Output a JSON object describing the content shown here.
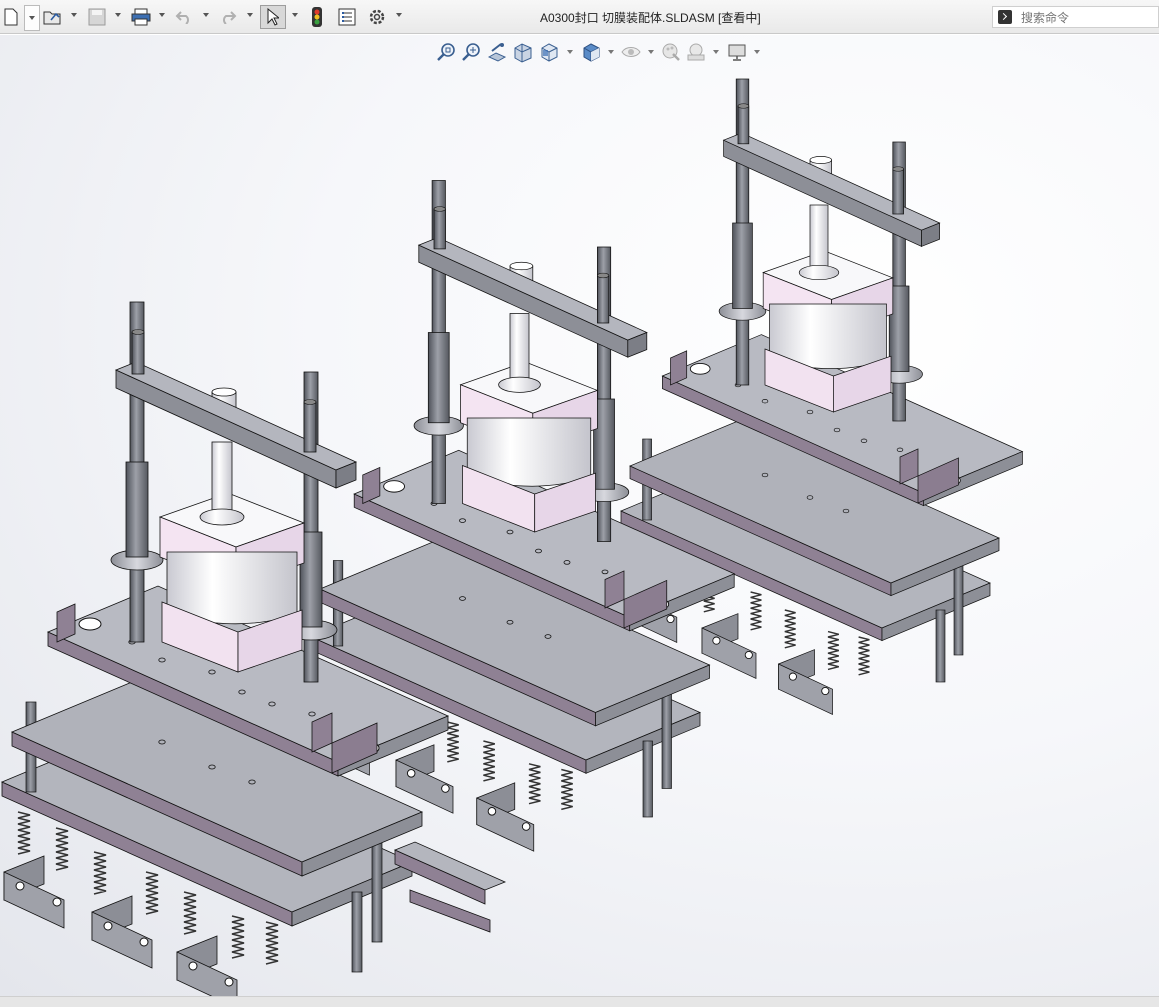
{
  "window": {
    "title": "A0300封口 切膜装配体.SLDASM [查看中]"
  },
  "toolbar": {
    "items": [
      {
        "name": "new-document",
        "icon": "new-document-icon"
      },
      {
        "name": "open",
        "icon": "open-folder-icon"
      },
      {
        "name": "save",
        "icon": "save-icon"
      },
      {
        "name": "print",
        "icon": "print-icon"
      },
      {
        "name": "undo",
        "icon": "undo-icon"
      },
      {
        "name": "redo",
        "icon": "redo-icon"
      },
      {
        "name": "select",
        "icon": "cursor-icon"
      },
      {
        "name": "rebuild",
        "icon": "traffic-light-icon"
      },
      {
        "name": "file-properties",
        "icon": "properties-icon"
      },
      {
        "name": "options",
        "icon": "gear-icon"
      }
    ]
  },
  "search": {
    "placeholder": "搜索命令"
  },
  "heads_up_toolbar": {
    "items": [
      {
        "name": "zoom-to-fit",
        "icon": "zoom-fit-icon"
      },
      {
        "name": "zoom-to-area",
        "icon": "zoom-area-icon"
      },
      {
        "name": "previous-view",
        "icon": "previous-view-icon"
      },
      {
        "name": "section-view",
        "icon": "section-view-icon"
      },
      {
        "name": "view-orientation",
        "icon": "view-orientation-icon"
      },
      {
        "name": "display-style",
        "icon": "display-style-icon"
      },
      {
        "name": "hide-show-items",
        "icon": "hide-show-icon"
      },
      {
        "name": "edit-appearance",
        "icon": "appearance-icon"
      },
      {
        "name": "apply-scene",
        "icon": "scene-icon"
      },
      {
        "name": "view-settings",
        "icon": "monitor-icon"
      }
    ]
  },
  "colors": {
    "plate": "#a3a5ad",
    "plate_top": "#b7b9c1",
    "plate_dark": "#75777f",
    "shadow": "#8f8194",
    "cylinder_body": "#f4e6f4",
    "cylinder_barrel": "#dddde3",
    "rod": "#6f727a",
    "bolt": "#5a4a40",
    "line": "#1a1a1a"
  }
}
